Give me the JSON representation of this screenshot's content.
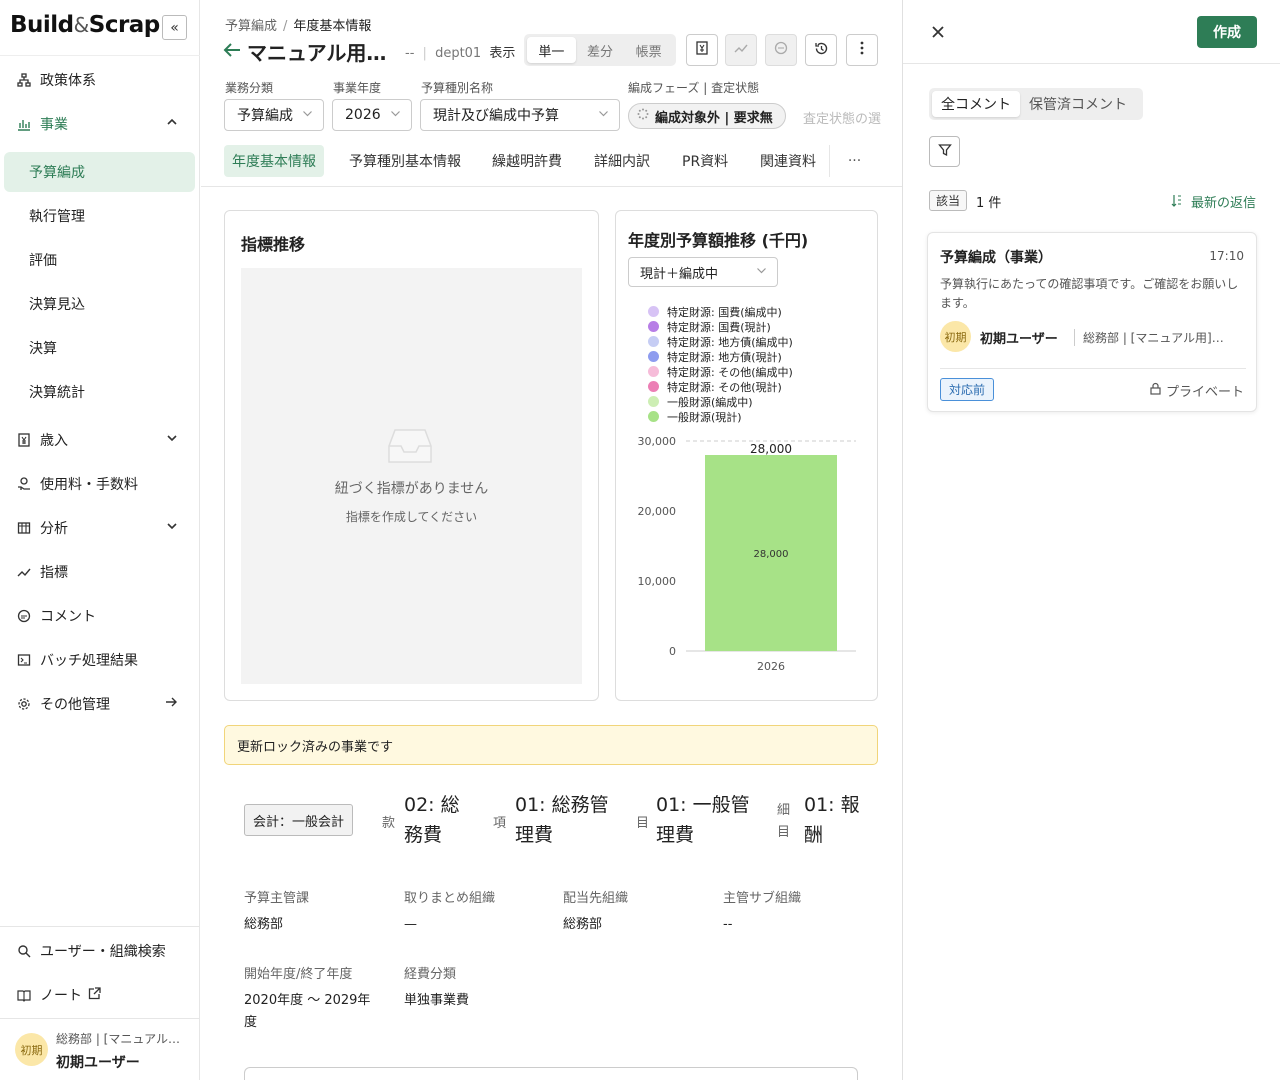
{
  "sidebar": {
    "logo_left": "Build",
    "logo_amp": "&",
    "logo_right": "Scrap",
    "collapse_icon": "«",
    "items": [
      {
        "label": "政策体系"
      },
      {
        "label": "事業"
      },
      {
        "label": "予算編成"
      },
      {
        "label": "執行管理"
      },
      {
        "label": "評価"
      },
      {
        "label": "決算見込"
      },
      {
        "label": "決算"
      },
      {
        "label": "決算統計"
      },
      {
        "label": "歳入"
      },
      {
        "label": "使用料・手数料"
      },
      {
        "label": "分析"
      },
      {
        "label": "指標"
      },
      {
        "label": "コメント"
      },
      {
        "label": "バッチ処理結果"
      },
      {
        "label": "その他管理"
      },
      {
        "label": "ユーザー・組織検索"
      },
      {
        "label": "ノート"
      }
    ],
    "user": {
      "avatar": "初期",
      "dept": "総務部 | [マニュアル用]初期ユーザー",
      "name": "初期ユーザー"
    }
  },
  "header": {
    "breadcrumb": [
      "予算編成",
      "年度基本情報"
    ],
    "title": "マニュアル用…",
    "dept_prefix": "--",
    "dept": "dept01",
    "show_label": "表示",
    "view_modes": [
      "単一",
      "差分",
      "帳票"
    ],
    "active_view": "単一"
  },
  "filters": {
    "business_category": {
      "label": "業務分類",
      "value": "予算編成"
    },
    "fiscal_year": {
      "label": "事業年度",
      "value": "2026"
    },
    "budget_type": {
      "label": "予算種別名称",
      "value": "現計及び編成中予算"
    },
    "phase": {
      "label": "編成フェーズ | 査定状態",
      "value": "編成対象外 | 要求無"
    },
    "assessment_status": "査定状態の選択"
  },
  "tabs": [
    "年度基本情報",
    "予算種別基本情報",
    "繰越明許費",
    "詳細内訳",
    "PR資料",
    "関連資料"
  ],
  "tabs_more": "···",
  "indicator_card": {
    "title": "指標推移",
    "empty_main": "紐づく指標がありません",
    "empty_sub": "指標を作成してください"
  },
  "budget_card": {
    "title": "年度別予算額推移 (千円)",
    "select_value": "現計＋編成中"
  },
  "chart_data": {
    "type": "bar",
    "stacked": true,
    "categories": [
      "2026"
    ],
    "series": [
      {
        "name": "特定財源: 国費(編成中)",
        "color": "#d7c3f5",
        "values": [
          0
        ]
      },
      {
        "name": "特定財源: 国費(現計)",
        "color": "#b77ee6",
        "values": [
          0
        ]
      },
      {
        "name": "特定財源: 地方債(編成中)",
        "color": "#c6cdf4",
        "values": [
          0
        ]
      },
      {
        "name": "特定財源: 地方債(現計)",
        "color": "#8e9cef",
        "values": [
          0
        ]
      },
      {
        "name": "特定財源: その他(編成中)",
        "color": "#f6bcd9",
        "values": [
          0
        ]
      },
      {
        "name": "特定財源: その他(現計)",
        "color": "#ec7fb5",
        "values": [
          0
        ]
      },
      {
        "name": "一般財源(編成中)",
        "color": "#cdeeb4",
        "values": [
          0
        ]
      },
      {
        "name": "一般財源(現計)",
        "color": "#a7e287",
        "values": [
          28000
        ]
      }
    ],
    "total_labels": [
      "28,000"
    ],
    "segment_labels": [
      "28,000"
    ],
    "y_ticks": [
      "0",
      "10,000",
      "20,000",
      "30,000"
    ],
    "ylim": [
      0,
      30000
    ],
    "grid": false,
    "legend_position": "top-left"
  },
  "lock_banner": "更新ロック済みの事業です",
  "account": {
    "tag": "会計：一般会計",
    "kan_label": "款",
    "kan_value": [
      "02: 総",
      "務費"
    ],
    "kou_label": "項",
    "kou_value": [
      "01: 総務管",
      "理費"
    ],
    "moku_label": "目",
    "moku_value": [
      "01: 一般管",
      "理費"
    ],
    "saimoku_label": [
      "細",
      "目"
    ],
    "saimoku_value": [
      "01: 報",
      "酬"
    ]
  },
  "info": {
    "budget_owner": {
      "label": "予算主管課",
      "value": "総務部"
    },
    "coordinator": {
      "label": "取りまとめ組織",
      "value": "—"
    },
    "allocation": {
      "label": "配当先組織",
      "value": "総務部"
    },
    "sub_org": {
      "label": "主管サブ組織",
      "value": "--"
    },
    "period": {
      "label": "開始年度/終了年度",
      "value": [
        "2020年度 ～ 2029年",
        "度"
      ]
    },
    "expense_type": {
      "label": "経費分類",
      "value": "単独事業費"
    }
  },
  "comments_panel": {
    "create_label": "作成",
    "tabs": [
      "全コメント",
      "保管済コメント"
    ],
    "active_tab": "全コメント",
    "match_label": "該当",
    "match_count": "1 件",
    "sort_label": "最新の返信",
    "comment": {
      "title": "予算編成（事業）",
      "time": "17:10",
      "body": "予算執行にあたっての確認事項です。ご確認をお願いします。",
      "avatar": "初期",
      "user": "初期ユーザー",
      "dept": "総務部 | [マニュアル用]初期ユーザー",
      "status": "対応前",
      "privacy": "プライベート"
    }
  },
  "colors": {
    "accent": "#2e7d56",
    "accent_bg": "#e3f1e8",
    "banner_bg": "#fff9e0",
    "status_blue": "#2b6cb0"
  }
}
